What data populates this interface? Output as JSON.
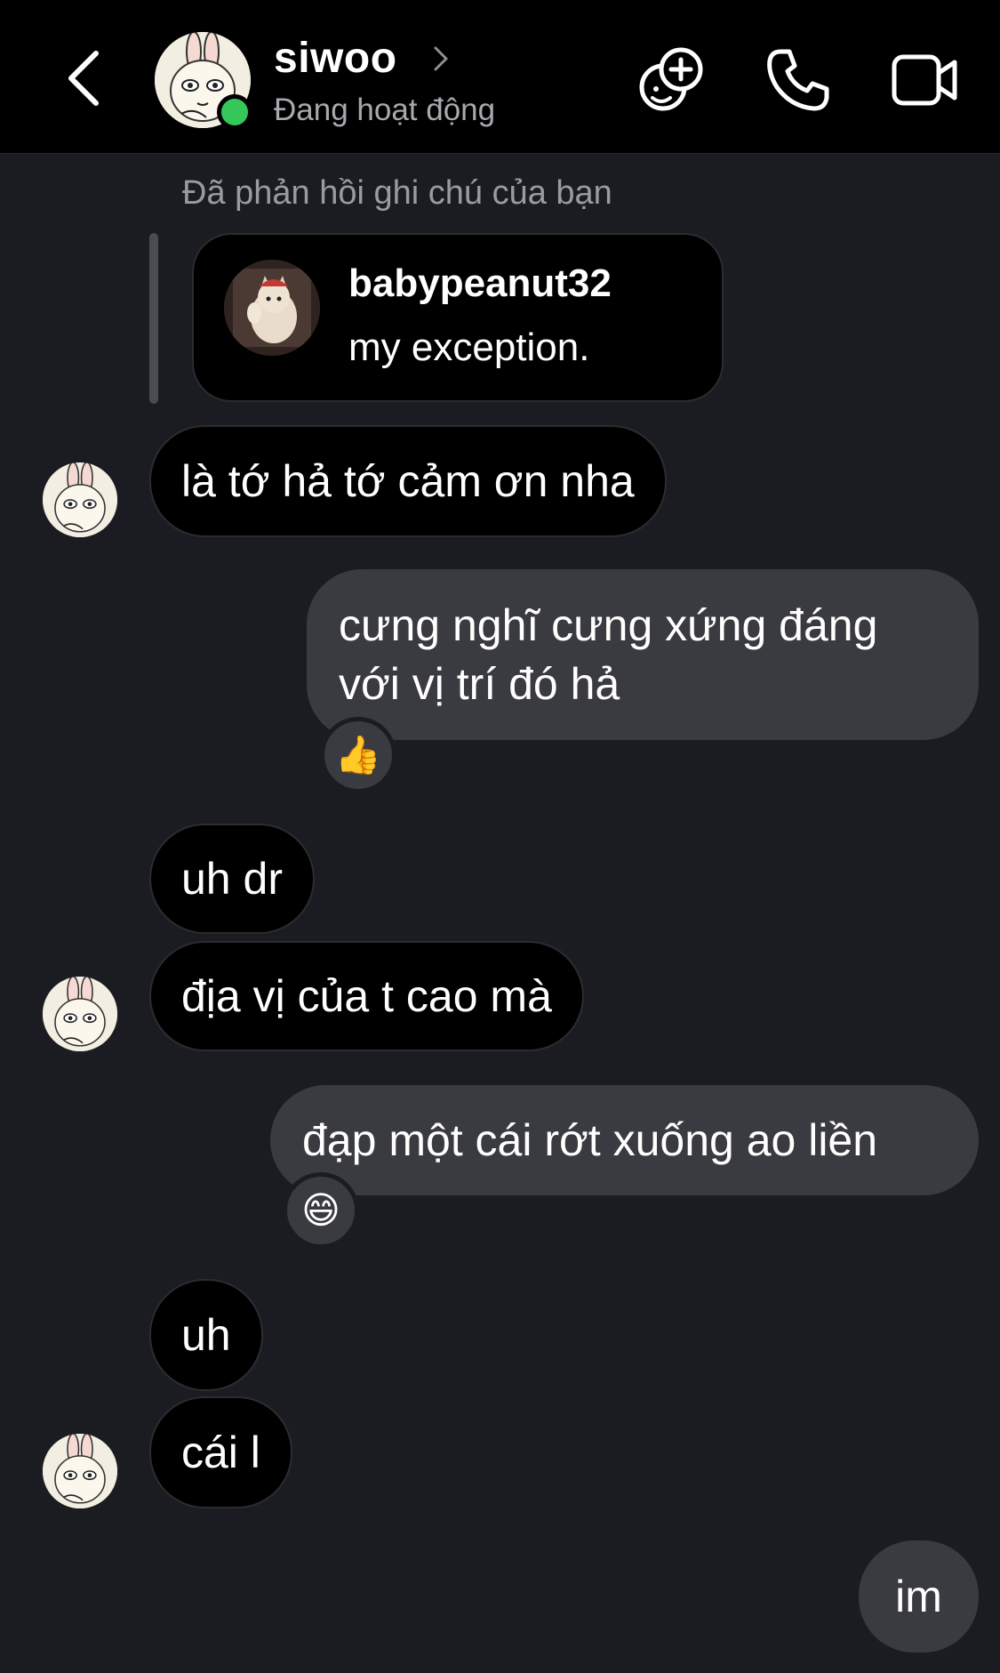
{
  "header": {
    "contact_name": "siwoo",
    "status": "Đang hoạt động",
    "icons": [
      "back-chevron-icon",
      "avatar",
      "online-status-dot",
      "name-chevron-icon",
      "add-effects-icon",
      "phone-call-icon",
      "video-call-icon"
    ],
    "online_color": "#35c759"
  },
  "reply_note": {
    "label": "Đã phản hồi ghi chú của bạn",
    "username": "babypeanut32",
    "text": "my exception."
  },
  "messages": [
    {
      "side": "in",
      "text": "là tớ hả tớ cảm ơn nha"
    },
    {
      "side": "out",
      "line1": "cưng nghĩ cưng xứng đáng",
      "line2": "với vị trí đó hả",
      "reaction": "👍"
    },
    {
      "side": "in",
      "text": "uh dr"
    },
    {
      "side": "in",
      "text": "địa vị của t cao mà"
    },
    {
      "side": "out",
      "text": "đạp một cái rớt xuống ao liền",
      "reaction": "😄"
    },
    {
      "side": "in",
      "text": "uh"
    },
    {
      "side": "in",
      "text": "cái l"
    },
    {
      "side": "out",
      "text": "im"
    }
  ],
  "colors": {
    "background": "#1b1c21",
    "header_bg": "#000000",
    "incoming_bubble": "#000000",
    "outgoing_bubble": "#3a3b40",
    "secondary_text": "#a8a9ae"
  }
}
